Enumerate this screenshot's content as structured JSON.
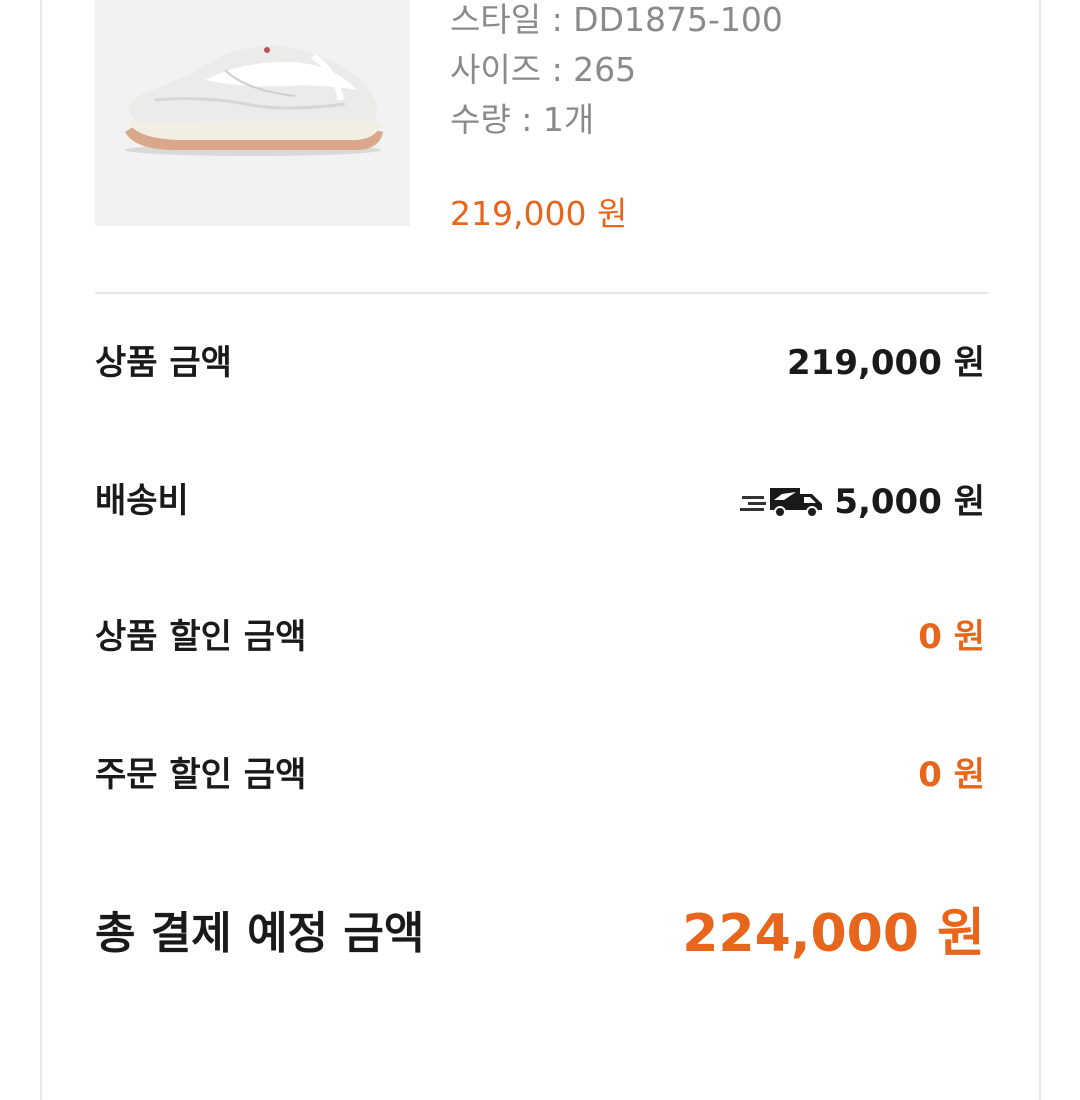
{
  "product": {
    "image_alt": "white sneaker",
    "style": "스타일 : DD1875-100",
    "size": "사이즈 : 265",
    "quantity": "수량 : 1개",
    "price": "219,000 원"
  },
  "summary": {
    "rows": [
      {
        "label": "상품 금액",
        "value": "219,000 원"
      },
      {
        "label": "배송비",
        "value": "5,000 원",
        "icon": "delivery-truck-icon"
      },
      {
        "label": "상품 할인 금액",
        "value": "0 원"
      },
      {
        "label": "주문 할인 금액",
        "value": "0 원"
      }
    ],
    "total_label": "총 결제 예정 금액",
    "total_value": "224,000 원"
  },
  "colors": {
    "accent": "#e8661c",
    "text": "#1a1a1a",
    "muted": "#8a8a8a",
    "divider": "#e6e6e6"
  }
}
